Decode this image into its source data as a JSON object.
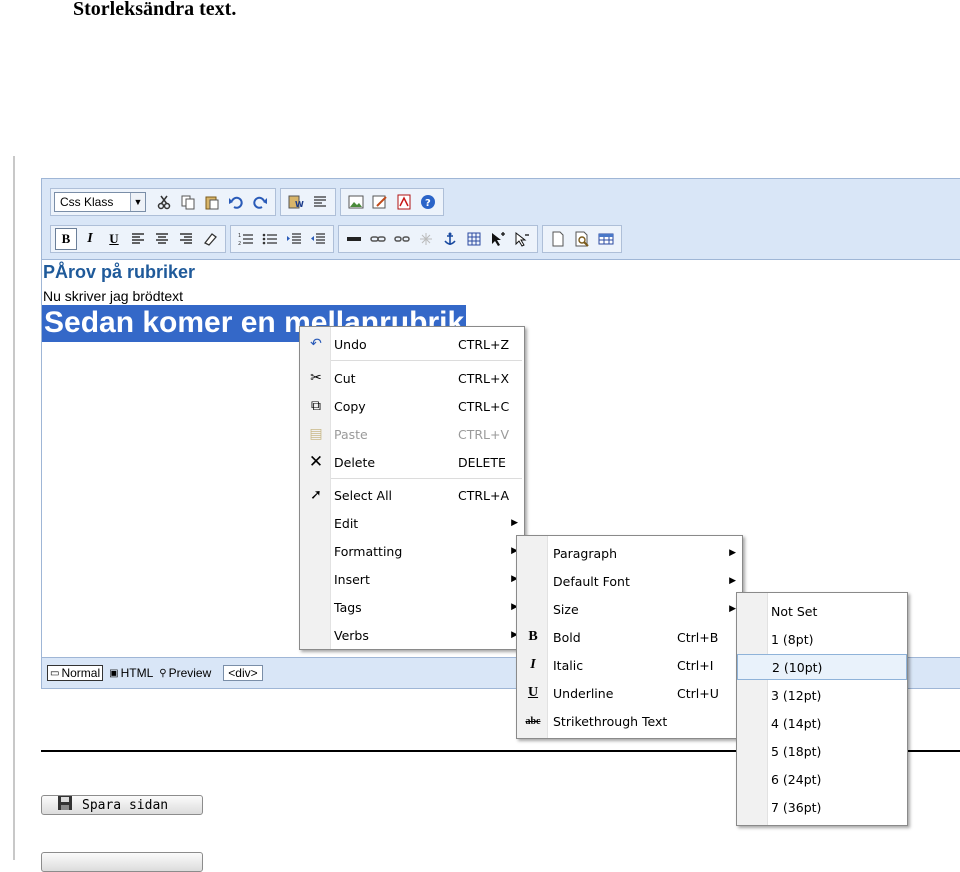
{
  "document": {
    "heading": "Storleksändra text."
  },
  "toolbar": {
    "css_class_label": "Css Klass",
    "row1_icons": [
      "cut-icon",
      "copy-icon",
      "paste-icon",
      "undo-icon",
      "redo-icon",
      "paste-word-icon",
      "paste-text-icon",
      "insert-image-icon",
      "edit-image-icon",
      "pdf-icon",
      "help-icon"
    ],
    "row2_icons": [
      "bold-icon",
      "italic-icon",
      "underline-icon",
      "align-left-icon",
      "align-center-icon",
      "align-right-icon",
      "eraser-icon",
      "ordered-list-icon",
      "unordered-list-icon",
      "indent-icon",
      "outdent-icon",
      "horizontal-rule-icon",
      "link-icon",
      "unlink-icon",
      "remove-link-icon",
      "anchor-icon",
      "table-icon",
      "select-all-icon",
      "pointer-icon",
      "new-page-icon",
      "preview-icon",
      "table-properties-icon"
    ]
  },
  "content": {
    "heading": "PÅrov på rubriker",
    "body_text": "Nu skriver jag brödtext",
    "selected_heading": "Sedan komer en mellanrubrik"
  },
  "statusbar": {
    "normal": "Normal",
    "html": "HTML",
    "preview": "Preview",
    "tag": "<div>"
  },
  "context_menu": {
    "items": [
      {
        "label": "Undo",
        "shortcut": "CTRL+Z",
        "icon": "undo-icon"
      },
      {
        "label": "Cut",
        "shortcut": "CTRL+X",
        "icon": "cut-icon"
      },
      {
        "label": "Copy",
        "shortcut": "CTRL+C",
        "icon": "copy-icon"
      },
      {
        "label": "Paste",
        "shortcut": "CTRL+V",
        "icon": "paste-icon",
        "disabled": true
      },
      {
        "label": "Delete",
        "shortcut": "DELETE",
        "icon": "delete-icon"
      },
      {
        "label": "Select All",
        "shortcut": "CTRL+A",
        "icon": "select-all-icon"
      },
      {
        "label": "Edit",
        "submenu": true
      },
      {
        "label": "Formatting",
        "submenu": true
      },
      {
        "label": "Insert",
        "submenu": true
      },
      {
        "label": "Tags",
        "submenu": true
      },
      {
        "label": "Verbs",
        "submenu": true
      }
    ]
  },
  "formatting_menu": {
    "items": [
      {
        "label": "Paragraph",
        "submenu": true
      },
      {
        "label": "Default Font",
        "submenu": true
      },
      {
        "label": "Size",
        "submenu": true
      },
      {
        "label": "Bold",
        "shortcut": "Ctrl+B",
        "icon": "bold-icon",
        "glyph": "B"
      },
      {
        "label": "Italic",
        "shortcut": "Ctrl+I",
        "icon": "italic-icon",
        "glyph": "I"
      },
      {
        "label": "Underline",
        "shortcut": "Ctrl+U",
        "icon": "underline-icon",
        "glyph": "U"
      },
      {
        "label": "Strikethrough Text",
        "icon": "strikethrough-icon",
        "glyph": "abc"
      }
    ]
  },
  "size_menu": {
    "items": [
      "Not Set",
      "1 (8pt)",
      "2 (10pt)",
      "3 (12pt)",
      "4 (14pt)",
      "5 (18pt)",
      "6 (24pt)",
      "7 (36pt)"
    ],
    "highlighted": "2 (10pt)"
  },
  "buttons": {
    "save": "Spara sidan"
  },
  "colors": {
    "toolbar_bg": "#d9e6f7",
    "selection": "#3468c8",
    "heading": "#1f5a9a",
    "menu_highlight": "#e9f2fb"
  }
}
